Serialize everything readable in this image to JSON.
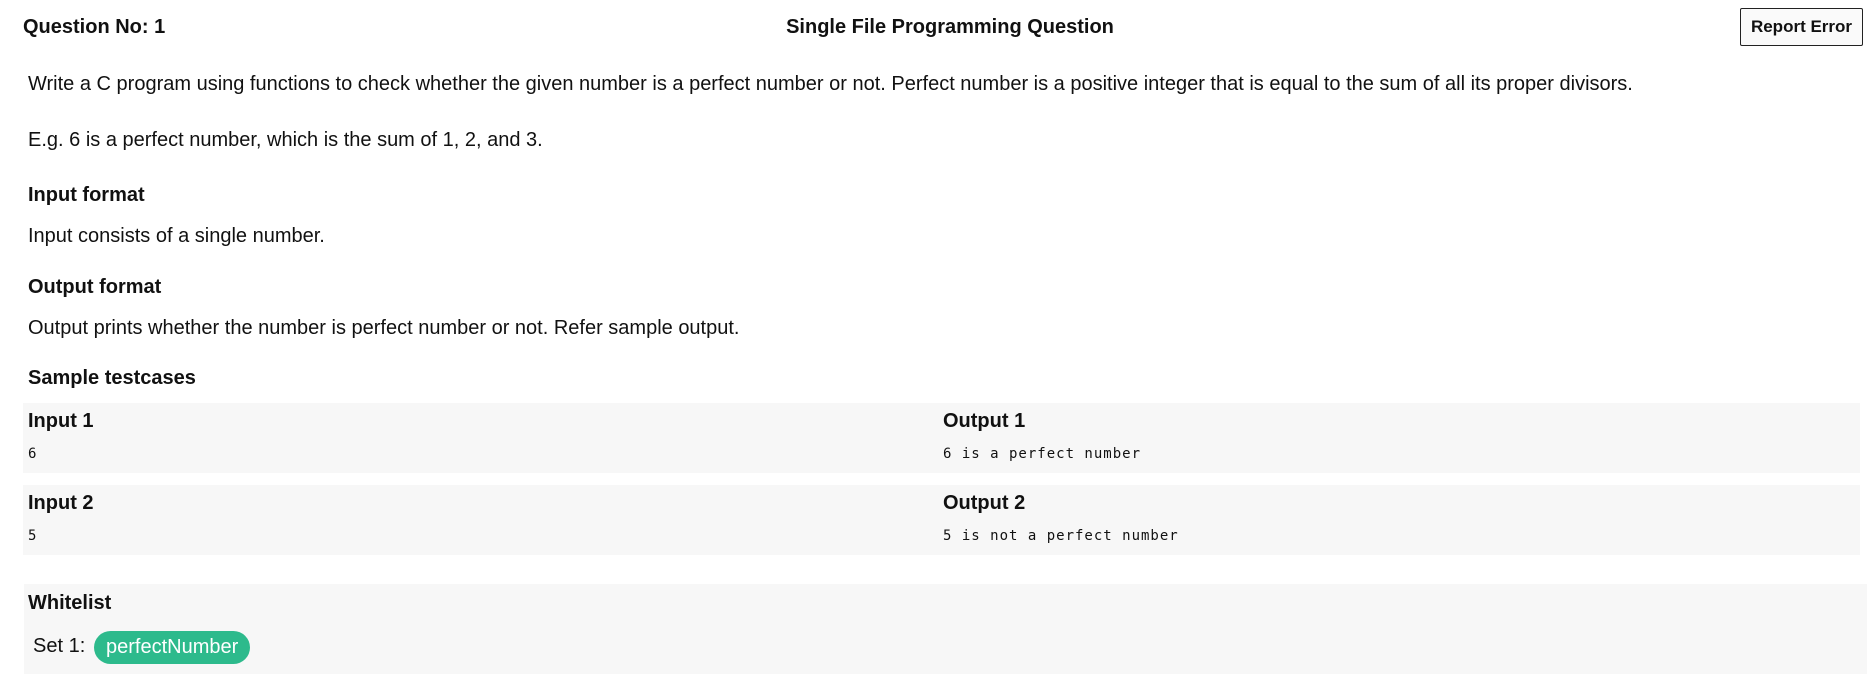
{
  "header": {
    "question_no": "Question No: 1",
    "title": "Single File Programming Question",
    "report_button": "Report Error"
  },
  "question": {
    "statement": "Write a C program using functions to check whether the given number is a perfect number or not. Perfect number is a positive integer that is equal to the sum of all its proper divisors.",
    "example": "E.g. 6 is a perfect number, which is the sum of 1, 2, and 3.",
    "input_format_heading": "Input format",
    "input_format_text": "Input consists of a single number.",
    "output_format_heading": "Output format",
    "output_format_text": "Output prints whether the number is perfect number or not. Refer sample output.",
    "samples_heading": "Sample testcases"
  },
  "testcases": [
    {
      "input_label": "Input 1",
      "input_value": "6",
      "output_label": "Output 1",
      "output_value": "6 is a perfect number"
    },
    {
      "input_label": "Input 2",
      "input_value": "5",
      "output_label": "Output 2",
      "output_value": "5 is not a perfect number"
    }
  ],
  "whitelist": {
    "heading": "Whitelist",
    "set_label": "Set 1:",
    "items": [
      "perfectNumber"
    ]
  },
  "colors": {
    "chip_background": "#2dba8c",
    "panel_background": "#f7f7f7"
  }
}
